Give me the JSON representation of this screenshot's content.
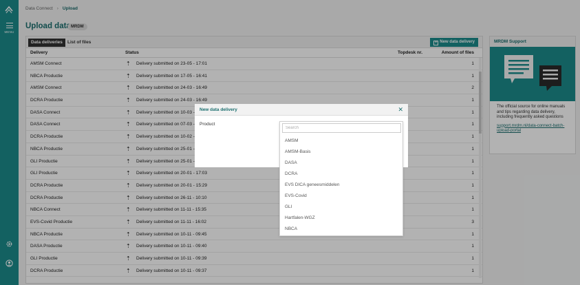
{
  "sidebar": {
    "logo_icon": "mrdm-logo-icon",
    "menu_label": "MENU",
    "bottom_icons": [
      "gear-icon",
      "user-icon"
    ]
  },
  "breadcrumb": {
    "parent": "Data Connect",
    "current": "Upload"
  },
  "page": {
    "title": "Upload data",
    "badge": "MRDM"
  },
  "tabs": [
    {
      "label": "Data deliveries",
      "active": true
    },
    {
      "label": "List of files",
      "active": false
    }
  ],
  "new_delivery_button": "New data delivery",
  "table": {
    "headers": {
      "delivery": "Delivery",
      "status": "Status",
      "topdesk": "Topdesk nr.",
      "amount": "Amount of files"
    },
    "rows": [
      {
        "delivery": "AMSM Connect",
        "status": "Delivery submitted on 23-05 - 17:01",
        "topdesk": "",
        "amount": "1"
      },
      {
        "delivery": "NBCA Productie",
        "status": "Delivery submitted on 17-05 - 16:41",
        "topdesk": "",
        "amount": "1"
      },
      {
        "delivery": "AMSM Connect",
        "status": "Delivery submitted on 24-03 - 16:49",
        "topdesk": "",
        "amount": "2"
      },
      {
        "delivery": "DCRA Productie",
        "status": "Delivery submitted on 24-03 - 16:49",
        "topdesk": "",
        "amount": "1"
      },
      {
        "delivery": "DASA Connect",
        "status": "Delivery submitted on 10-03 - 1",
        "topdesk": "",
        "amount": "1"
      },
      {
        "delivery": "DASA Connect",
        "status": "Delivery submitted on 07-03 - 0",
        "topdesk": "",
        "amount": "1"
      },
      {
        "delivery": "DCRA Productie",
        "status": "Delivery submitted on 10-02 - 1",
        "topdesk": "",
        "amount": "1"
      },
      {
        "delivery": "NBCA Productie",
        "status": "Delivery submitted on 25-01 - 1",
        "topdesk": "",
        "amount": "1"
      },
      {
        "delivery": "GLI Productie",
        "status": "Delivery submitted on 25-01 - 1",
        "topdesk": "",
        "amount": "1"
      },
      {
        "delivery": "GLI Productie",
        "status": "Delivery submitted on 20-01 - 17:03",
        "topdesk": "",
        "amount": "1"
      },
      {
        "delivery": "DCRA Productie",
        "status": "Delivery submitted on 20-01 - 15:29",
        "topdesk": "",
        "amount": "1"
      },
      {
        "delivery": "DCRA Productie",
        "status": "Delivery submitted on 26-11 - 10:10",
        "topdesk": "",
        "amount": "1"
      },
      {
        "delivery": "NBCA Connect",
        "status": "Delivery submitted on 11-11 - 15:35",
        "topdesk": "",
        "amount": "1"
      },
      {
        "delivery": "EVS-Covid Productie",
        "status": "Delivery submitted on 11-11 - 16:02",
        "topdesk": "",
        "amount": "3"
      },
      {
        "delivery": "NBCA Productie",
        "status": "Delivery submitted on 10-11 - 09:45",
        "topdesk": "",
        "amount": "1"
      },
      {
        "delivery": "DASA Productie",
        "status": "Delivery submitted on 10-11 - 09:40",
        "topdesk": "",
        "amount": "1"
      },
      {
        "delivery": "GLI Productie",
        "status": "Delivery submitted on 10-11 - 09:39",
        "topdesk": "",
        "amount": "1"
      },
      {
        "delivery": "DCRA Productie",
        "status": "Delivery submitted on 10-11 - 09:37",
        "topdesk": "",
        "amount": "1"
      }
    ]
  },
  "support": {
    "title": "MRDM Support",
    "text": "The official source for online manuals and tips regarding data delivery, including frequently asked questions",
    "link": "support.mrdm.nl/data-connect-batch-upload-portal"
  },
  "modal": {
    "title": "New data delivery",
    "product_label": "Product",
    "close_icon": "close-icon"
  },
  "dropdown": {
    "search_placeholder": "Search",
    "options": [
      "AMSM",
      "AMSM-Basis",
      "DASA",
      "DCRA",
      "EVS DICA geneesmiddelen",
      "EVS-Covid",
      "GLI",
      "Hartfalen-WGZ",
      "NBCA"
    ]
  },
  "colors": {
    "brand": "#1c8c8c",
    "brand_dark": "#1a6e6e"
  }
}
